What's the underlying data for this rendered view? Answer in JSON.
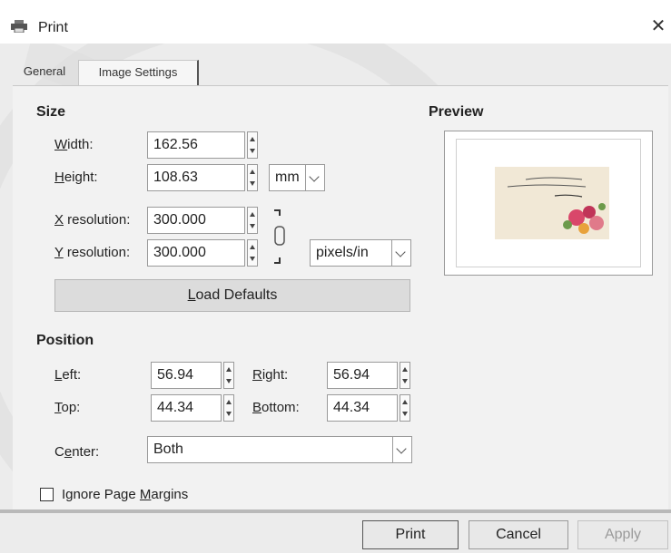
{
  "window": {
    "title": "Print",
    "close_glyph": "✕"
  },
  "tabs": [
    {
      "label": "General",
      "active": false
    },
    {
      "label": "Image Settings",
      "active": true
    }
  ],
  "size": {
    "title": "Size",
    "width": {
      "label_accel": "W",
      "label_rest": "idth:",
      "value": "162.56"
    },
    "height": {
      "label_accel": "H",
      "label_rest": "eight:",
      "value": "108.63"
    },
    "unit": "mm",
    "x_res": {
      "label_accel": "X",
      "label_rest": " resolution:",
      "value": "300.000"
    },
    "y_res": {
      "label_accel": "Y",
      "label_rest": " resolution:",
      "value": "300.000"
    },
    "res_unit": "pixels/in",
    "load_defaults_accel": "L",
    "load_defaults_rest": "oad Defaults"
  },
  "position": {
    "title": "Position",
    "left": {
      "label_accel": "L",
      "label_rest": "eft:",
      "value": "56.94"
    },
    "right": {
      "label_accel": "R",
      "label_rest": "ight:",
      "value": "56.94"
    },
    "top": {
      "label_accel": "T",
      "label_rest": "op:",
      "value": "44.34"
    },
    "bottom": {
      "label_accel": "B",
      "label_rest": "ottom:",
      "value": "44.34"
    },
    "center": {
      "label_pre": "C",
      "label_accel": "e",
      "label_rest": "nter:",
      "value": "Both"
    }
  },
  "ignore_margins": {
    "label_pre": "Ignore Page ",
    "label_accel": "M",
    "label_rest": "argins",
    "checked": false
  },
  "preview": {
    "title": "Preview"
  },
  "footer": {
    "print": "Print",
    "cancel": "Cancel",
    "apply": "Apply"
  },
  "colors": {
    "panel": "#f2f2f2",
    "apply_disabled_text": "#9a9a9a"
  }
}
